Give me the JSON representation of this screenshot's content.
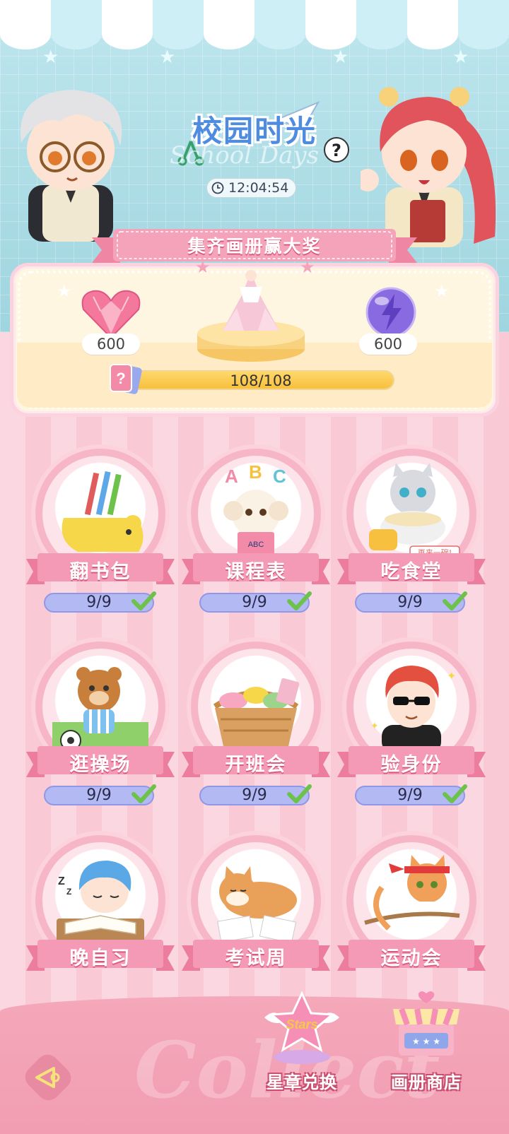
{
  "event": {
    "title": "校园时光",
    "title_bg_text": "School Days",
    "help": "?",
    "timer": "12:04:54"
  },
  "prize": {
    "ribbon": "集齐画册赢大奖",
    "left_reward_count": "600",
    "right_reward_count": "600",
    "progress_text": "108/108",
    "progress_fraction": 1.0
  },
  "cards": [
    {
      "label": "翻书包",
      "count": "9/9",
      "completed": true,
      "icon": "pencil-case-icon"
    },
    {
      "label": "课程表",
      "count": "9/9",
      "completed": true,
      "icon": "abc-puppy-icon"
    },
    {
      "label": "吃食堂",
      "count": "9/9",
      "completed": true,
      "icon": "cat-noodles-icon",
      "art_text": "再来一碗!"
    },
    {
      "label": "逛操场",
      "count": "9/9",
      "completed": true,
      "icon": "bear-soccer-icon"
    },
    {
      "label": "开班会",
      "count": "9/9",
      "completed": true,
      "icon": "snack-basket-icon"
    },
    {
      "label": "验身份",
      "count": "9/9",
      "completed": true,
      "icon": "cool-boy-icon"
    },
    {
      "label": "晚自习",
      "icon": "sleeping-student-icon"
    },
    {
      "label": "考试周",
      "icon": "shiba-exam-icon"
    },
    {
      "label": "运动会",
      "icon": "cat-tug-icon"
    }
  ],
  "bottom": {
    "watermark": "Collect",
    "stars_badge": "Stars",
    "exchange_label": "星章兑换",
    "shop_label": "画册商店"
  },
  "colors": {
    "accent_pink": "#f28aa8",
    "title_blue": "#4f8ce0",
    "progress_yellow": "#f7c03e",
    "count_lavender": "#b3b9f3",
    "check_green": "#6cc24a"
  }
}
